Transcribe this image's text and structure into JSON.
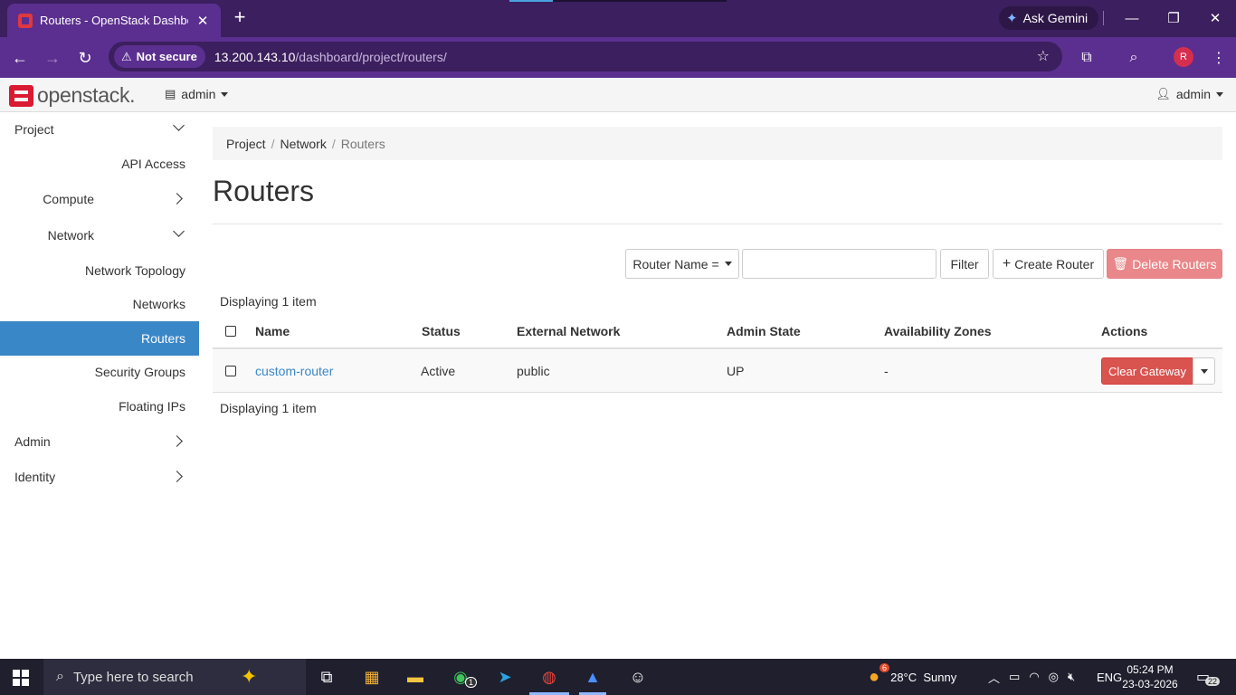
{
  "browser": {
    "tab_title": "Routers - OpenStack Dashboard",
    "gemini_label": "Ask Gemini",
    "security_label": "Not secure",
    "url_host": "13.200.143.10",
    "url_path": "/dashboard/project/routers/",
    "profile_initial": "R"
  },
  "header": {
    "logo_text": "openstack.",
    "project_selector": "admin",
    "user_menu": "admin"
  },
  "sidebar": {
    "project": "Project",
    "api_access": "API Access",
    "compute": "Compute",
    "network": "Network",
    "network_topology": "Network Topology",
    "networks": "Networks",
    "routers": "Routers",
    "security_groups": "Security Groups",
    "floating_ips": "Floating IPs",
    "admin": "Admin",
    "identity": "Identity"
  },
  "breadcrumb": {
    "items": [
      "Project",
      "Network"
    ],
    "current": "Routers",
    "separator": "/"
  },
  "page": {
    "title": "Routers"
  },
  "actions": {
    "filter_field": "Router Name =",
    "filter_value": "",
    "filter_button": "Filter",
    "create_button": "Create Router",
    "delete_button": "Delete Routers"
  },
  "table": {
    "count_top": "Displaying 1 item",
    "count_bottom": "Displaying 1 item",
    "columns": [
      "Name",
      "Status",
      "External Network",
      "Admin State",
      "Availability Zones",
      "Actions"
    ],
    "rows": [
      {
        "name": "custom-router",
        "status": "Active",
        "external_network": "public",
        "admin_state": "UP",
        "availability_zones": "-",
        "action": "Clear Gateway"
      }
    ]
  },
  "taskbar": {
    "search_placeholder": "Type here to search",
    "whatsapp_badge": "1",
    "weather_badge": "6",
    "weather": "28°C  Sunny",
    "language": "ENG",
    "time": "05:24 PM",
    "date": "23-03-2026",
    "notification_count": "22"
  },
  "colors": {
    "browser_frame": "#3c1f5e",
    "browser_toolbar": "#5b2f8f",
    "active_nav": "#3a87c8",
    "link": "#3a87c8",
    "danger": "#d9534f",
    "danger_disabled": "#e9878a",
    "openstack_red": "#da1a32"
  }
}
